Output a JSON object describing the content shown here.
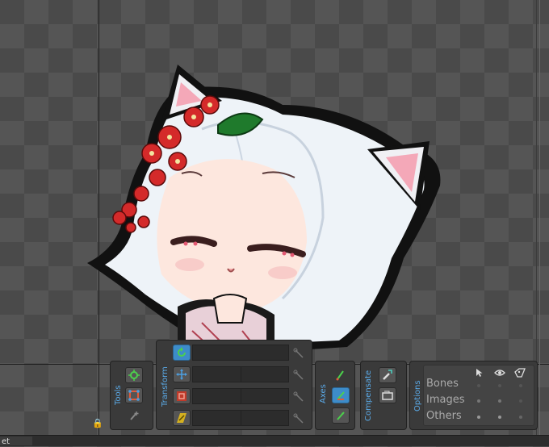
{
  "panels": {
    "tools": {
      "label": "Tools"
    },
    "transform": {
      "label": "Transform"
    },
    "axes": {
      "label": "Axes"
    },
    "compensate": {
      "label": "Compensate"
    },
    "options": {
      "label": "Options",
      "rows": [
        {
          "label": "Bones"
        },
        {
          "label": "Images"
        },
        {
          "label": "Others"
        }
      ]
    }
  },
  "bottom_tab": {
    "label": "et"
  },
  "icons": {
    "tools": [
      "pose-icon",
      "weights-icon",
      "create-icon"
    ],
    "transform": [
      "rotate-icon",
      "translate-icon",
      "scale-icon",
      "shear-icon"
    ],
    "axes": [
      "local-axes-icon",
      "parent-axes-icon",
      "world-axes-icon"
    ],
    "compensate": [
      "compensate-bones-icon",
      "compensate-images-icon"
    ],
    "options_header": [
      "select-icon",
      "visibility-icon",
      "names-icon"
    ]
  },
  "colors": {
    "accent": "#5aa9e6",
    "active_button": "#3d8cc9",
    "panel_bg": "#3a3a3a"
  }
}
